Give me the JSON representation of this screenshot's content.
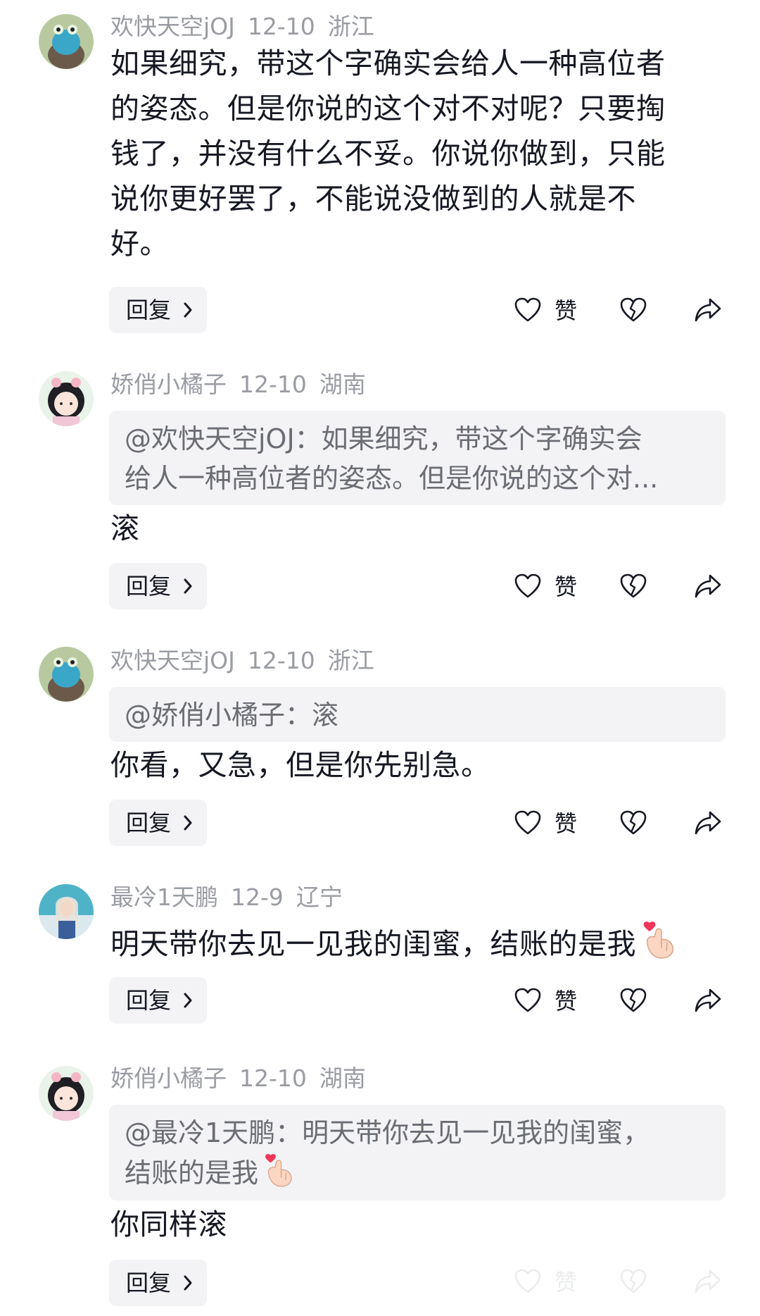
{
  "comments": [
    {
      "user": "欢快天空jOJ",
      "date": "12-10",
      "location": "浙江",
      "text_lines": [
        "如果细究，带这个字确实会给人一种高位者",
        "的姿态。但是你说的这个对不对呢？只要掏",
        "钱了，并没有什么不妥。你说你做到，只能",
        "说你更好罢了，不能说没做到的人就是不",
        "好。"
      ],
      "reply_label": "回复",
      "like_label": "赞"
    },
    {
      "user": "娇俏小橘子",
      "date": "12-10",
      "location": "湖南",
      "quote_lines": [
        "@欢快天空jOJ：如果细究，带这个字确实会",
        "给人一种高位者的姿态。但是你说的这个对..."
      ],
      "text": "滚",
      "reply_label": "回复",
      "like_label": "赞"
    },
    {
      "user": "欢快天空jOJ",
      "date": "12-10",
      "location": "浙江",
      "quote": "@娇俏小橘子：滚",
      "text": "你看，又急，但是你先别急。",
      "reply_label": "回复",
      "like_label": "赞"
    },
    {
      "user": "最冷1天鹏",
      "date": "12-9",
      "location": "辽宁",
      "text": "明天带你去见一见我的闺蜜，结账的是我",
      "emoji": "finger-heart",
      "reply_label": "回复",
      "like_label": "赞"
    },
    {
      "user": "娇俏小橘子",
      "date": "12-10",
      "location": "湖南",
      "quote_lines": [
        "@最冷1天鹏：明天带你去见一见我的闺蜜，",
        "结账的是我"
      ],
      "quote_emoji": "finger-heart",
      "text": "你同样滚",
      "reply_label": "回复",
      "like_label": "赞"
    }
  ],
  "colors": {
    "text": "#161823",
    "meta": "#9a9ca3",
    "bubble": "#f3f3f5"
  }
}
